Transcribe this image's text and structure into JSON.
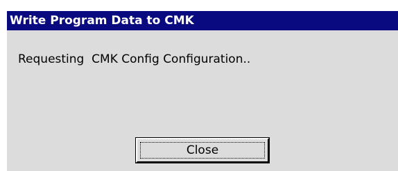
{
  "window": {
    "title": "Write Program Data to CMK"
  },
  "body": {
    "message": "Requesting  CMK Config Configuration.."
  },
  "buttons": {
    "close_label": "Close"
  },
  "colors": {
    "title_bar": "#0a0a80",
    "title_text": "#ffffff",
    "dialog_bg": "#dcdcdc"
  }
}
